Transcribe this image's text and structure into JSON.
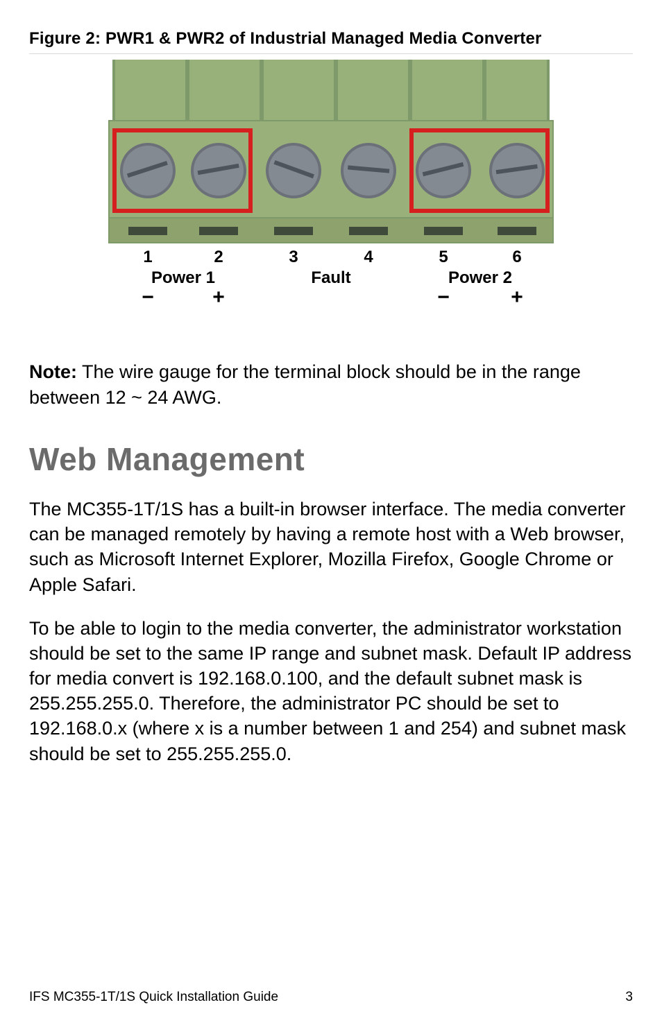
{
  "figure": {
    "caption": "Figure 2: PWR1 & PWR2 of Industrial Managed Media Converter",
    "labels": {
      "n1": "1",
      "n2": "2",
      "n3": "3",
      "n4": "4",
      "n5": "5",
      "n6": "6",
      "group1": "Power 1",
      "group2": "Fault",
      "group3": "Power 2",
      "neg1": "−",
      "pos1": "+",
      "neg2": "−",
      "pos2": "+"
    }
  },
  "note": {
    "label": "Note:",
    "text": "The wire gauge for the terminal block should be in the range between 12 ~ 24 AWG."
  },
  "section": {
    "heading": "Web Management",
    "p1": "The MC355-1T/1S has a built-in browser interface. The media converter can be managed remotely by having a remote host with a Web browser, such as Microsoft Internet Explorer, Mozilla Firefox, Google Chrome or Apple Safari.",
    "p2": "To be able to login to the media converter, the administrator workstation should be set to the same IP range and subnet mask. Default IP address for media convert is 192.168.0.100, and the default subnet mask is 255.255.255.0. Therefore, the administrator PC should be set to 192.168.0.x (where x is a number between 1 and 254) and subnet mask should be set to 255.255.255.0."
  },
  "footer": {
    "left": "IFS MC355-1T/1S Quick Installation Guide",
    "right": "3"
  }
}
